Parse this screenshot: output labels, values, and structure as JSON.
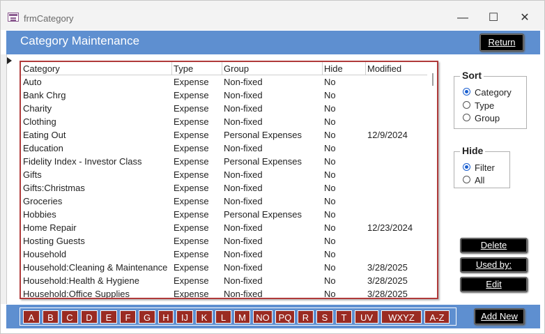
{
  "window": {
    "title": "frmCategory",
    "minimize": "—",
    "maximize": "☐",
    "close": "✕"
  },
  "header": {
    "title": "Category Maintenance",
    "return_label": "Return"
  },
  "list": {
    "columns": [
      "Category",
      "Type",
      "Group",
      "Hide",
      "Modified"
    ],
    "rows": [
      [
        "Auto",
        "Expense",
        "Non-fixed",
        "No",
        ""
      ],
      [
        "Bank Chrg",
        "Expense",
        "Non-fixed",
        "No",
        ""
      ],
      [
        "Charity",
        "Expense",
        "Non-fixed",
        "No",
        ""
      ],
      [
        "Clothing",
        "Expense",
        "Non-fixed",
        "No",
        ""
      ],
      [
        "Eating Out",
        "Expense",
        "Personal Expenses",
        "No",
        "12/9/2024"
      ],
      [
        "Education",
        "Expense",
        "Non-fixed",
        "No",
        ""
      ],
      [
        "Fidelity Index - Investor Class",
        "Expense",
        "Personal Expenses",
        "No",
        ""
      ],
      [
        "Gifts",
        "Expense",
        "Non-fixed",
        "No",
        ""
      ],
      [
        "Gifts:Christmas",
        "Expense",
        "Non-fixed",
        "No",
        ""
      ],
      [
        "Groceries",
        "Expense",
        "Non-fixed",
        "No",
        ""
      ],
      [
        "Hobbies",
        "Expense",
        "Personal Expenses",
        "No",
        ""
      ],
      [
        "Home Repair",
        "Expense",
        "Non-fixed",
        "No",
        "12/23/2024"
      ],
      [
        "Hosting Guests",
        "Expense",
        "Non-fixed",
        "No",
        ""
      ],
      [
        "Household",
        "Expense",
        "Non-fixed",
        "No",
        ""
      ],
      [
        "Household:Cleaning & Maintenance",
        "Expense",
        "Non-fixed",
        "No",
        "3/28/2025"
      ],
      [
        "Household:Health & Hygiene",
        "Expense",
        "Non-fixed",
        "No",
        "3/28/2025"
      ],
      [
        "Household:Office Supplies",
        "Expense",
        "Non-fixed",
        "No",
        "3/28/2025"
      ]
    ]
  },
  "sort": {
    "legend": "Sort",
    "options": [
      "Category",
      "Type",
      "Group"
    ],
    "selected": "Category"
  },
  "hide": {
    "legend": "Hide",
    "options": [
      "Filter",
      "All"
    ],
    "selected": "Filter"
  },
  "actions": {
    "delete_label": "Delete",
    "used_by_label": "Used by:",
    "edit_label": "Edit",
    "add_new_label": "Add New"
  },
  "alphabet": [
    "A",
    "B",
    "C",
    "D",
    "E",
    "F",
    "G",
    "H",
    "IJ",
    "K",
    "L",
    "M",
    "NO",
    "PQ",
    "R",
    "S",
    "T",
    "UV",
    "WXYZ",
    "A-Z"
  ],
  "colors": {
    "header_blue": "#5e8fd0",
    "letter_button": "#9a2b22",
    "list_border": "#b03a3a"
  }
}
